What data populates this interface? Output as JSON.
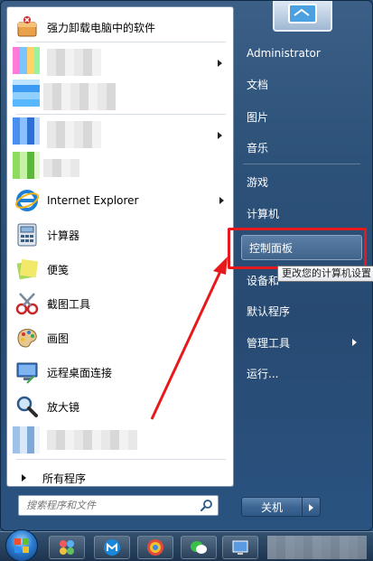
{
  "left_pane": {
    "programs": [
      {
        "label": "强力卸载电脑中的软件",
        "icon": "uninstall-box-icon"
      },
      {
        "label": "Internet Explorer",
        "icon": "internet-explorer-icon",
        "has_submenu": true
      },
      {
        "label": "计算器",
        "icon": "calculator-icon"
      },
      {
        "label": "便笺",
        "icon": "sticky-notes-icon"
      },
      {
        "label": "截图工具",
        "icon": "snipping-tool-icon"
      },
      {
        "label": "画图",
        "icon": "paint-icon"
      },
      {
        "label": "远程桌面连接",
        "icon": "remote-desktop-icon"
      },
      {
        "label": "放大镜",
        "icon": "magnifier-icon"
      }
    ],
    "all_programs": "所有程序",
    "search_placeholder": "搜索程序和文件"
  },
  "right_pane": {
    "items": [
      {
        "label": "Administrator"
      },
      {
        "label": "文档"
      },
      {
        "label": "图片"
      },
      {
        "label": "音乐"
      },
      {
        "label": "游戏"
      },
      {
        "label": "计算机"
      },
      {
        "label": "控制面板"
      },
      {
        "label": "设备和"
      },
      {
        "label": "默认程序"
      },
      {
        "label": "管理工具",
        "has_submenu": true
      },
      {
        "label": "运行..."
      }
    ],
    "tooltip": "更改您的计算机设置",
    "shutdown_label": "关机"
  },
  "colors": {
    "highlight_red": "#e8191c",
    "menu_blue": "#2d5279"
  }
}
